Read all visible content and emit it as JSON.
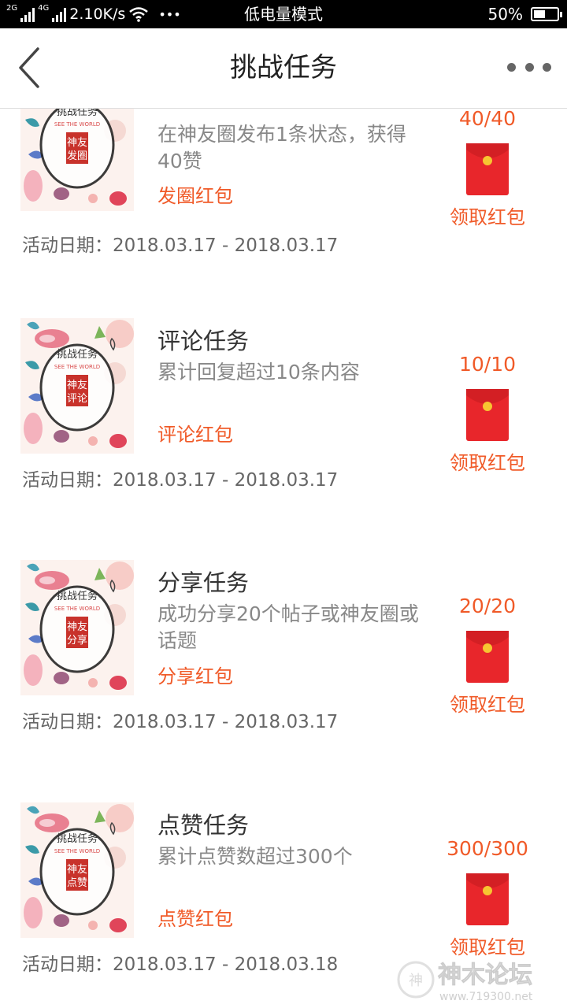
{
  "status_bar": {
    "net_2g": "2G",
    "net_4g": "4G",
    "speed": "2.10K/s",
    "dots": "•••",
    "mode": "低电量模式",
    "battery": "50%",
    "battery_level": 0.5
  },
  "nav": {
    "title": "挑战任务"
  },
  "thumb_text": {
    "line1": "挑战任务",
    "line2": "SEE THE WORLD"
  },
  "tasks": [
    {
      "title": "",
      "thumb_label": "神友发圈",
      "desc": "在神友圈发布1条状态，获得40赞",
      "tag": "发圈红包",
      "progress": "40/40",
      "action": "领取红包",
      "date": "活动日期：2018.03.17 - 2018.03.17"
    },
    {
      "title": "评论任务",
      "thumb_label": "神友评论",
      "desc": "累计回复超过10条内容",
      "tag": "评论红包",
      "progress": "10/10",
      "action": "领取红包",
      "date": "活动日期：2018.03.17 - 2018.03.17"
    },
    {
      "title": "分享任务",
      "thumb_label": "神友分享",
      "desc": "成功分享20个帖子或神友圈或话题",
      "tag": "分享红包",
      "progress": "20/20",
      "action": "领取红包",
      "date": "活动日期：2018.03.17 - 2018.03.17"
    },
    {
      "title": "点赞任务",
      "thumb_label": "神友点赞",
      "desc": "累计点赞数超过300个",
      "tag": "点赞红包",
      "progress": "300/300",
      "action": "领取红包",
      "date": "活动日期：2018.03.17 - 2018.03.18"
    }
  ],
  "watermark": {
    "text": "神木论坛",
    "url": "www.719300.net"
  },
  "colors": {
    "accent": "#f05a28",
    "packet": "#e8262b",
    "coin": "#f7c531"
  }
}
